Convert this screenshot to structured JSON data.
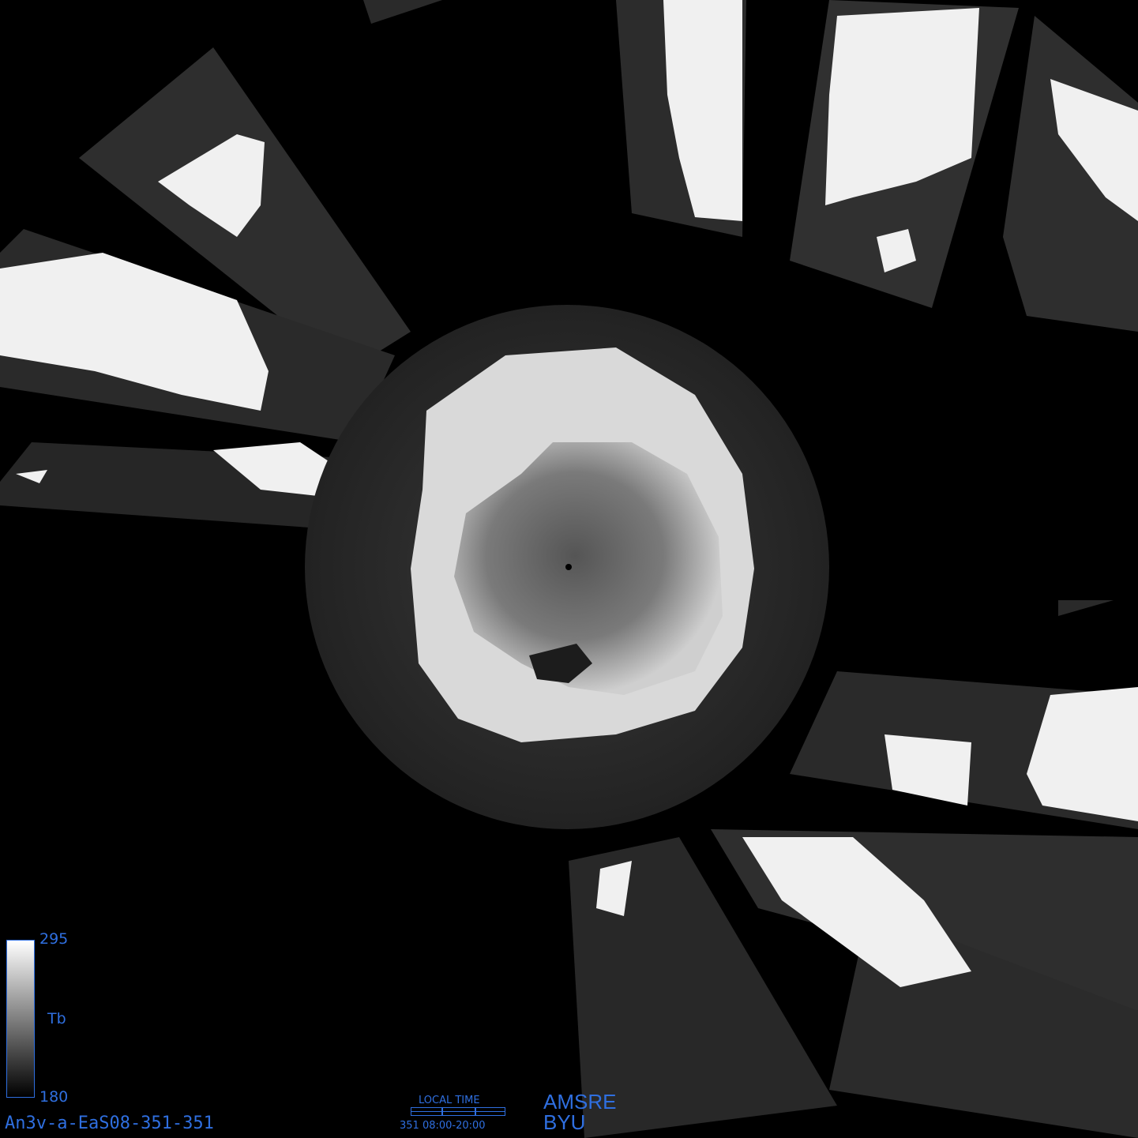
{
  "colorbar": {
    "max_label": "295",
    "min_label": "180",
    "variable_label": "Tb"
  },
  "footer": {
    "file_id": "An3v-a-EaS08-351-351",
    "local_time_title": "LOCAL TIME",
    "local_time_range": "351 08:00-20:00",
    "brand_line1": "AMSRE",
    "brand_line2": "BYU"
  },
  "colors": {
    "text_accent": "#2f6fe0",
    "background": "#000000",
    "land_warm": "#f2f2f2",
    "ocean": "#2b2b2b",
    "ice_sheet": "#8a8a8a"
  }
}
